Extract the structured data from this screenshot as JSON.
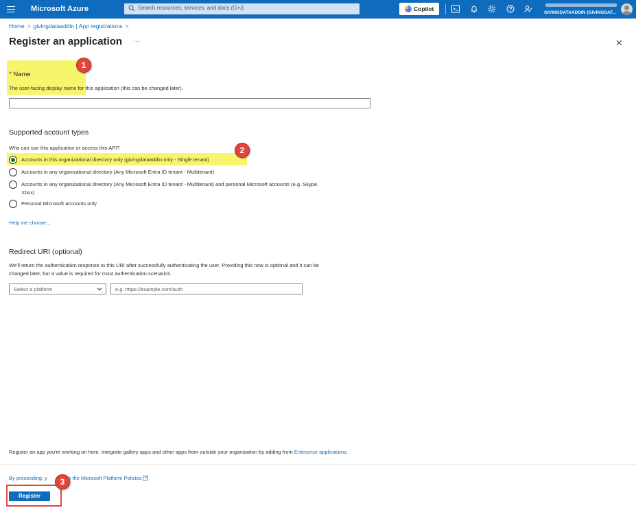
{
  "topbar": {
    "brand": "Microsoft Azure",
    "search_placeholder": "Search resources, services, and docs (G+/)",
    "copilot_label": "Copilot",
    "account_directory": "GIVINGDATAADDIN (GIVINGDAT...",
    "icons": [
      "hamburger-icon",
      "search-icon",
      "cloud-shell-icon",
      "notifications-icon",
      "settings-icon",
      "help-icon",
      "feedback-icon",
      "avatar"
    ]
  },
  "breadcrumb": {
    "items": [
      "Home",
      "givingdataaddin | App registrations"
    ]
  },
  "page": {
    "title": "Register an application"
  },
  "name_section": {
    "required_marker": "*",
    "label": "Name",
    "help": "The user-facing display name for this application (this can be changed later).",
    "value": ""
  },
  "account_types": {
    "heading": "Supported account types",
    "question": "Who can use this application or access this API?",
    "options": [
      {
        "label": "Accounts in this organizational directory only (givingdataaddin only - Single tenant)",
        "selected": true
      },
      {
        "label": "Accounts in any organizational directory (Any Microsoft Entra ID tenant - Multitenant)",
        "selected": false
      },
      {
        "label": "Accounts in any organizational directory (Any Microsoft Entra ID tenant - Multitenant) and personal Microsoft accounts (e.g. Skype,",
        "label_line2": "Xbox)",
        "selected": false
      },
      {
        "label": "Personal Microsoft accounts only",
        "selected": false
      }
    ],
    "help_link": "Help me choose..."
  },
  "redirect": {
    "heading": "Redirect URI (optional)",
    "desc_line1": "We'll return the authentication response to this URI after successfully authenticating the user. Providing this now is optional and it can be",
    "desc_line2": "changed later, but a value is required for most authentication scenarios.",
    "platform_select": "Select a platform",
    "uri_placeholder": "e.g. https://example.com/auth"
  },
  "footer": {
    "note_prefix": "Register an app you're working on here. Integrate gallery apps and other apps from outside your organization by adding from",
    "note_link": "Enterprise applications",
    "note_suffix": ".",
    "policy_prefix": "By proceeding, y",
    "policy_link": "e to the Microsoft Platform Policies",
    "register_label": "Register"
  },
  "annotations": {
    "badges": [
      "1",
      "2",
      "3"
    ],
    "highlight_color": "#f7f56b",
    "badge_color": "#e1463c"
  },
  "colors": {
    "accent": "#0f6cbd",
    "radio_selected": "#107c10"
  }
}
